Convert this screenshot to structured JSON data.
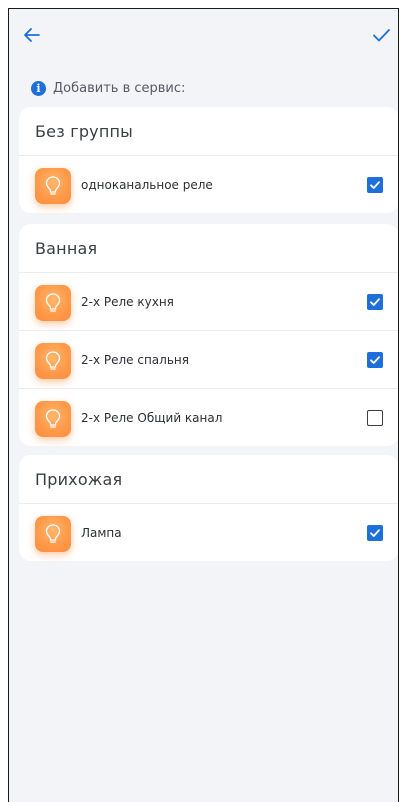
{
  "header": {
    "back_icon": "arrow-left-icon",
    "confirm_icon": "checkmark-icon",
    "accent_color": "#1e6fd9"
  },
  "info": {
    "icon": "info-icon",
    "icon_glyph": "i",
    "text": "Добавить в сервис:"
  },
  "groups": [
    {
      "name": "Без группы",
      "devices": [
        {
          "name": "одноканальное реле",
          "icon": "lightbulb-icon",
          "checked": true
        }
      ]
    },
    {
      "name": "Ванная",
      "devices": [
        {
          "name": "2-х  Реле кухня",
          "icon": "lightbulb-icon",
          "checked": true
        },
        {
          "name": "2-х  Реле спальня",
          "icon": "lightbulb-icon",
          "checked": true
        },
        {
          "name": "2-х  Реле Общий канал",
          "icon": "lightbulb-icon",
          "checked": false
        }
      ]
    },
    {
      "name": "Прихожая",
      "devices": [
        {
          "name": "Лампа",
          "icon": "lightbulb-icon",
          "checked": true
        }
      ]
    }
  ]
}
